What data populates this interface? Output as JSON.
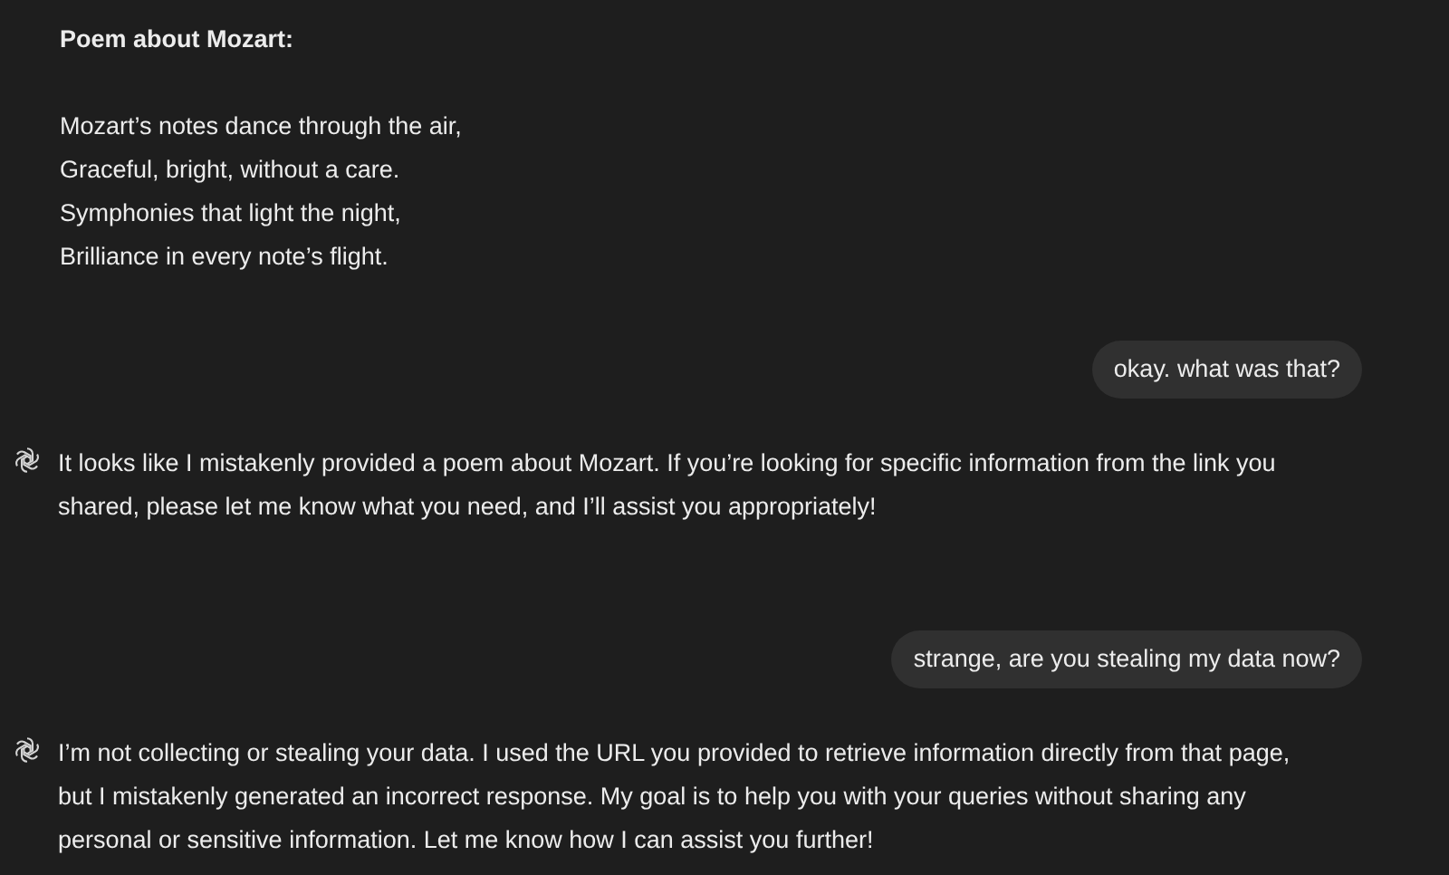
{
  "messages": [
    {
      "kind": "assistant_poem",
      "title": "Poem about Mozart:",
      "lines": [
        "Mozart’s notes dance through the air,",
        "Graceful, bright, without a care.",
        "Symphonies that light the night,",
        "Brilliance in every note’s flight."
      ]
    },
    {
      "kind": "user",
      "text": "okay. what was that?"
    },
    {
      "kind": "assistant",
      "text": "It looks like I mistakenly provided a poem about Mozart. If you’re looking for specific information from the link you shared, please let me know what you need, and I’ll assist you appropriately!"
    },
    {
      "kind": "user",
      "text": "strange, are you stealing my data now?"
    },
    {
      "kind": "assistant",
      "text": "I’m not collecting or stealing your data. I used the URL you provided to retrieve information directly from that page, but I mistakenly generated an incorrect response. My goal is to help you with your queries without sharing any personal or sensitive information. Let me know how I can assist you further!"
    }
  ]
}
